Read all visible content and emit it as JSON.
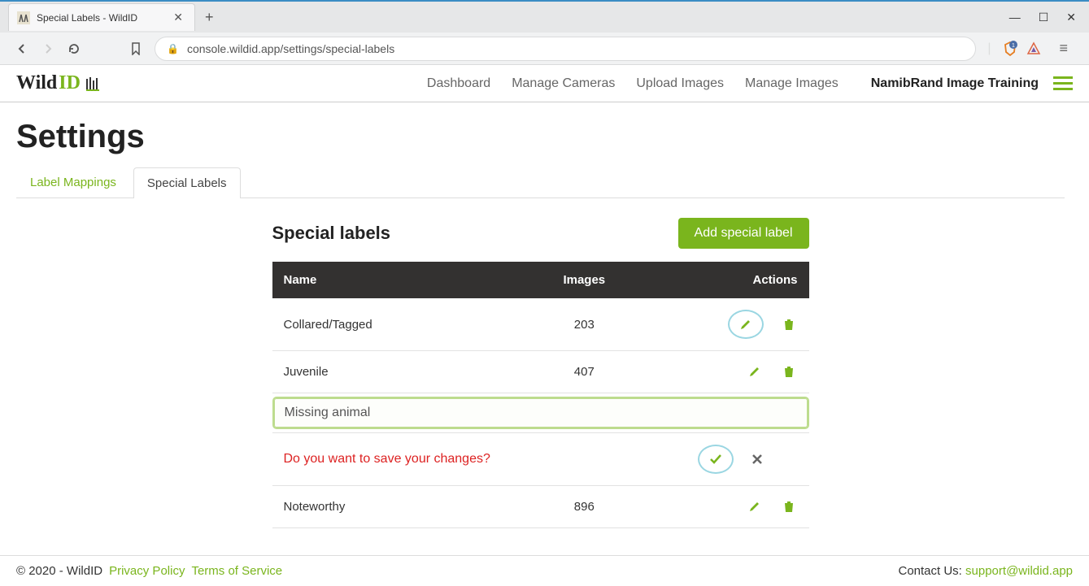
{
  "browser": {
    "tab_title": "Special Labels - WildID",
    "url": "console.wildid.app/settings/special-labels"
  },
  "header": {
    "nav": {
      "dashboard": "Dashboard",
      "manage_cameras": "Manage Cameras",
      "upload_images": "Upload Images",
      "manage_images": "Manage Images"
    },
    "account": "NamibRand Image Training"
  },
  "page": {
    "title": "Settings",
    "tabs": {
      "label_mappings": "Label Mappings",
      "special_labels": "Special Labels"
    }
  },
  "panel": {
    "title": "Special labels",
    "add_button": "Add special label",
    "columns": {
      "name": "Name",
      "images": "Images",
      "actions": "Actions"
    },
    "rows": [
      {
        "name": "Collared/Tagged",
        "images": "203"
      },
      {
        "name": "Juvenile",
        "images": "407"
      },
      {
        "name": "Noteworthy",
        "images": "896"
      }
    ],
    "edit_value": "Missing animal",
    "confirm_text": "Do you want to save your changes?"
  },
  "footer": {
    "copyright": "© 2020 - WildID",
    "privacy": "Privacy Policy",
    "terms": "Terms of Service",
    "contact_label": "Contact Us:",
    "contact_email": "support@wildid.app"
  }
}
